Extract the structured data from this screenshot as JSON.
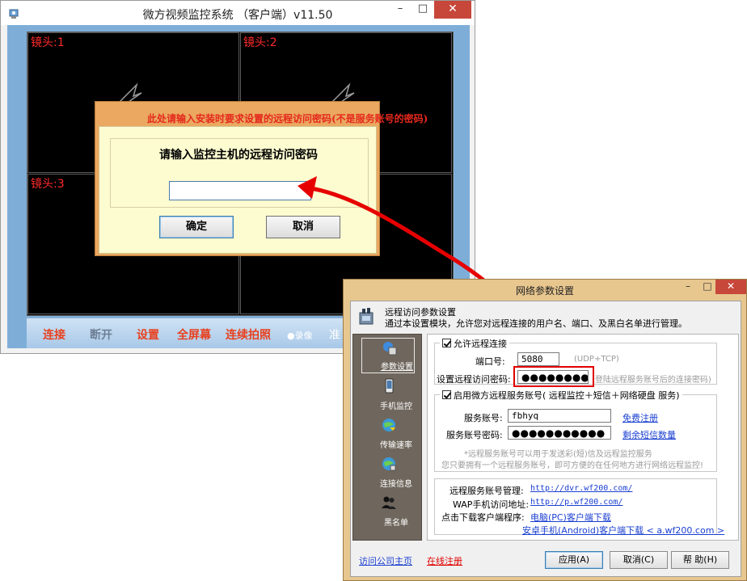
{
  "main_window": {
    "title": "微方视频监控系统 （客户端）v11.50",
    "controls": {
      "minimize": "–",
      "maximize": "□",
      "close": "✕"
    },
    "cameras": [
      {
        "label": "镜头:1"
      },
      {
        "label": "镜头:2"
      },
      {
        "label": "镜头:3"
      },
      {
        "label": ""
      }
    ],
    "toolbar": {
      "connect": "连接",
      "disconnect": "断开",
      "settings": "设置",
      "fullscreen": "全屏幕",
      "burst_photo": "连续拍照",
      "record": "●录像",
      "cut_text": "准"
    }
  },
  "password_dialog": {
    "hint": "此处请输入安装时要求设置的远程访问密码(不是服务账号的密码)",
    "prompt": "请输入监控主机的远程访问密码",
    "input_value": "",
    "ok_label": "确定",
    "cancel_label": "取消"
  },
  "network_window": {
    "title": "网络参数设置",
    "controls": {
      "minimize": "–",
      "maximize": "□",
      "close": "✕"
    },
    "header": {
      "title": "远程访问参数设置",
      "description": "通过本设置模块，允许您对远程连接的用户名、端口、及黑白名单进行管理。"
    },
    "sidebar": [
      {
        "label": "参数设置",
        "icon": "network-settings-icon",
        "selected": true
      },
      {
        "label": "手机监控",
        "icon": "mobile-phone-icon",
        "selected": false
      },
      {
        "label": "传输速率",
        "icon": "globe-speed-icon",
        "selected": false
      },
      {
        "label": "连接信息",
        "icon": "globe-info-icon",
        "selected": false
      },
      {
        "label": "黑名单",
        "icon": "blacklist-users-icon",
        "selected": false
      }
    ],
    "remote": {
      "group_label": "允许远程连接",
      "port_label": "端口号:",
      "port_value": "5080",
      "port_note": "(UDP+TCP)",
      "password_label": "设置远程访问密码:",
      "password_value": "●●●●●●●●●",
      "password_note": "(登陆远程服务账号后的连接密码)"
    },
    "service": {
      "group_label": "启用微方远程服务账号( 远程监控＋短信＋网络硬盘 服务)",
      "account_label": "服务账号:",
      "account_value": "fbhyq",
      "free_register": "免费注册",
      "account_password_label": "服务账号密码:",
      "account_password_value": "●●●●●●●●●●●",
      "sms_remaining": "剩余短信数量",
      "note_line1": "*远程服务账号可以用于发送彩(短)信及远程监控服务",
      "note_line2": "您只要拥有一个远程服务账号，即可方便的在任何地方进行网络远程监控!"
    },
    "links": {
      "manage_label": "远程服务账号管理:",
      "manage_url": "http://dvr.wf200.com/",
      "wap_label": "WAP手机访问地址:",
      "wap_url": "http://p.wf200.com/",
      "download_label": "点击下载客户端程序:",
      "pc_client": "电脑(PC)客户端下载",
      "android_client": "安卓手机(Android)客户端下载 < a.wf200.com >"
    },
    "footer": {
      "visit_home": "访问公司主页",
      "register_online": "在线注册",
      "apply": "应用(A)",
      "cancel": "取消(C)",
      "help": "帮 助(H)"
    }
  },
  "colors": {
    "accent_red": "#e00000",
    "toolbar_blue": "#7eaed8",
    "dialog_orange": "#eaa860",
    "dialog_yellow": "#fdfbd0",
    "link_blue": "#1a3fd0"
  }
}
